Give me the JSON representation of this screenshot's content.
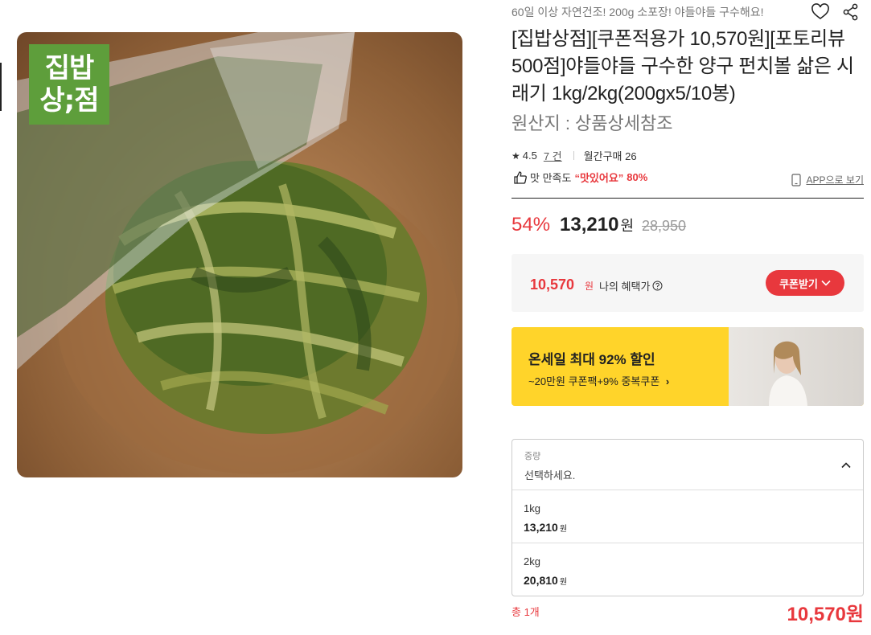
{
  "brand_logo": {
    "line1": "집밥",
    "line2": "상;점"
  },
  "product": {
    "subtitle": "60일 이상 자연건조! 200g 소포장! 야들야들 구수해요!",
    "title": "[집밥상점][쿠폰적용가 10,570원][포토리뷰 500점]야들야들 구수한 양구 펀치볼 삶은 시래기 1kg/2kg(200gx5/10봉)",
    "origin": "원산지 : 상품상세참조"
  },
  "rating": {
    "score": "4.5",
    "review_count": "7 건",
    "monthly": "월간구매 26"
  },
  "taste": {
    "prefix": "맛 만족도",
    "label": "“맛있어요”",
    "percent": "80%"
  },
  "app_link": "APP으로 보기",
  "price": {
    "discount": "54%",
    "sale": "13,210",
    "won": "원",
    "original": "28,950"
  },
  "benefit": {
    "price": "10,570",
    "won": "원",
    "label": "나의 혜택가",
    "coupon_button": "쿠폰받기"
  },
  "banner": {
    "title": "온세일 최대 92% 할인",
    "subtitle": "~20만원 쿠폰팩+9% 중복쿠폰"
  },
  "options": {
    "label": "중량",
    "placeholder": "선택하세요.",
    "items": [
      {
        "name": "1kg",
        "price": "13,210",
        "won": "원"
      },
      {
        "name": "2kg",
        "price": "20,810",
        "won": "원"
      }
    ]
  },
  "total": {
    "qty": "총 1개",
    "price": "10,570원"
  },
  "colors": {
    "accent": "#e8383d",
    "banner": "#ffd42a",
    "logo": "#5e9e3b"
  }
}
